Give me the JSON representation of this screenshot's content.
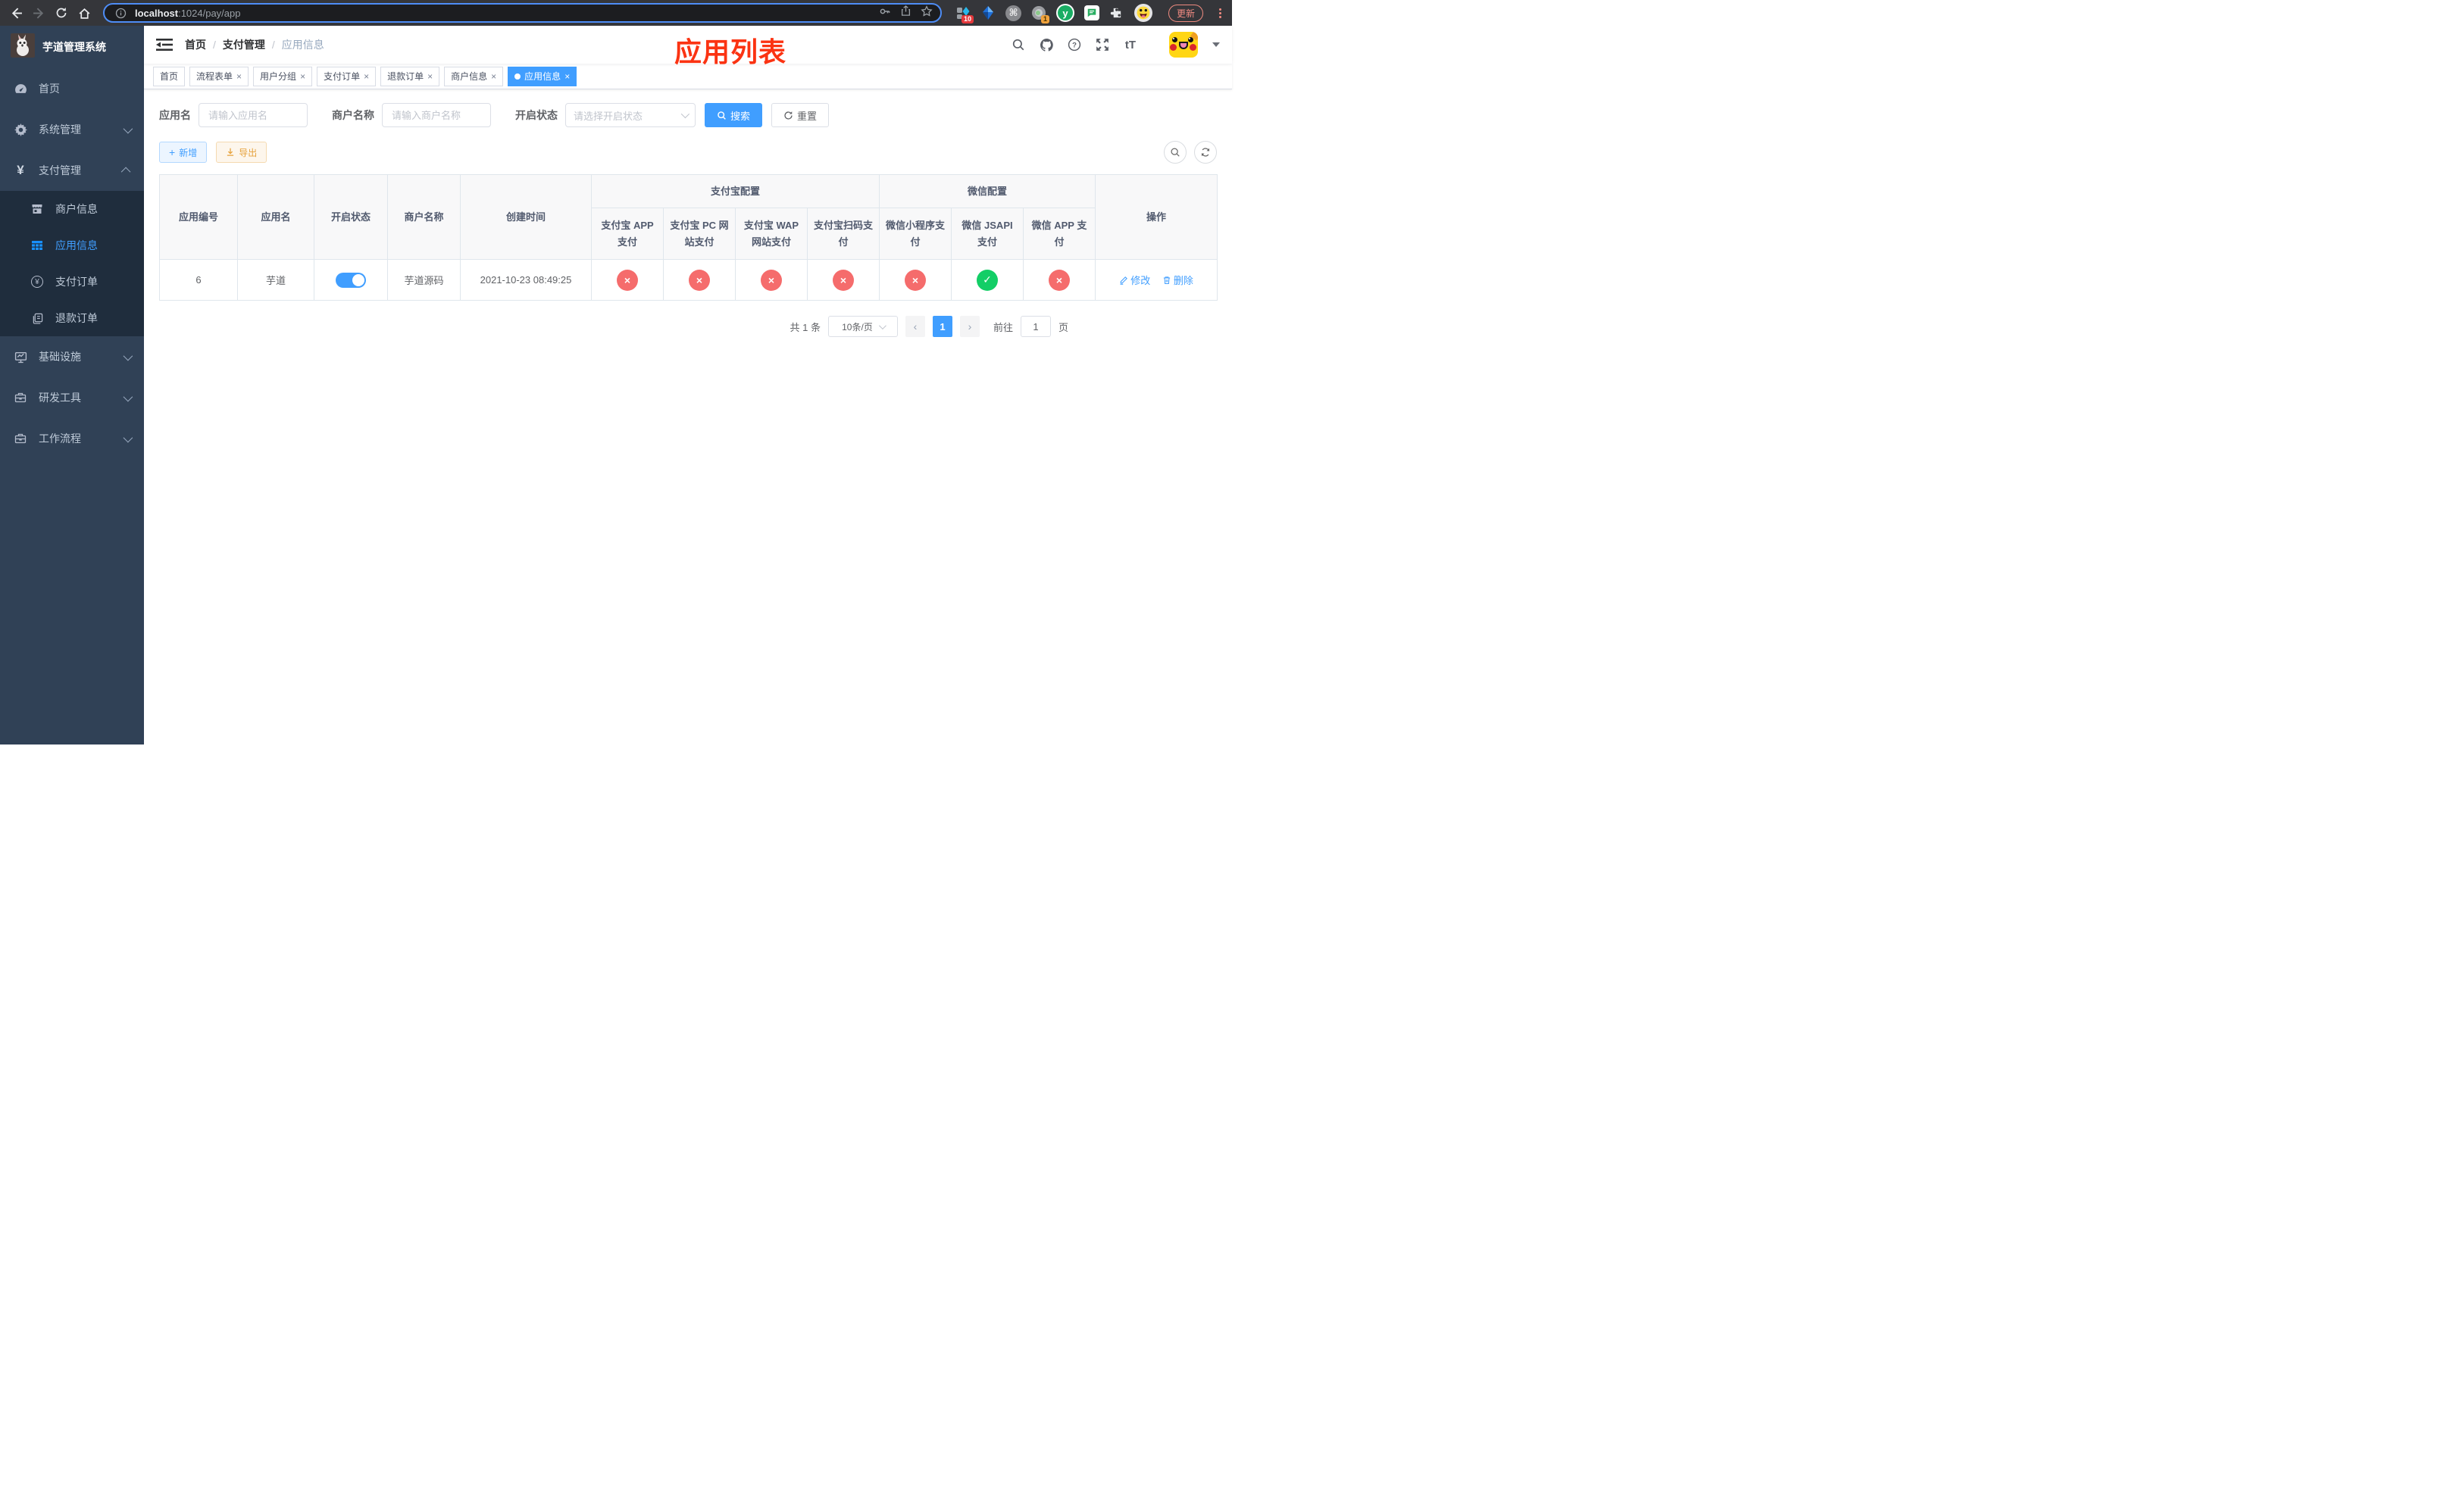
{
  "browser": {
    "url_host": "localhost",
    "url_path": ":1024/pay/app",
    "update_button": "更新",
    "ext_badge_blocks": "10",
    "ext_badge_lens": "1",
    "ext_y_letter": "y",
    "ext_command_glyph": "⌘"
  },
  "sidebar": {
    "title": "芋道管理系统",
    "items": [
      {
        "label": "首页"
      },
      {
        "label": "系统管理"
      },
      {
        "label": "支付管理"
      },
      {
        "label": "商户信息"
      },
      {
        "label": "应用信息"
      },
      {
        "label": "支付订单"
      },
      {
        "label": "退款订单"
      },
      {
        "label": "基础设施"
      },
      {
        "label": "研发工具"
      },
      {
        "label": "工作流程"
      }
    ]
  },
  "navbar": {
    "breadcrumb": [
      "首页",
      "支付管理",
      "应用信息"
    ],
    "separator": "/",
    "annotation": "应用列表",
    "fontsize_icon_text": "tT"
  },
  "tabs": [
    {
      "label": "首页",
      "closable": false,
      "active": false
    },
    {
      "label": "流程表单",
      "closable": true,
      "active": false
    },
    {
      "label": "用户分组",
      "closable": true,
      "active": false
    },
    {
      "label": "支付订单",
      "closable": true,
      "active": false
    },
    {
      "label": "退款订单",
      "closable": true,
      "active": false
    },
    {
      "label": "商户信息",
      "closable": true,
      "active": false
    },
    {
      "label": "应用信息",
      "closable": true,
      "active": true
    }
  ],
  "filters": {
    "app_name_label": "应用名",
    "app_name_placeholder": "请输入应用名",
    "merchant_label": "商户名称",
    "merchant_placeholder": "请输入商户名称",
    "status_label": "开启状态",
    "status_placeholder": "请选择开启状态",
    "search_label": "搜索",
    "reset_label": "重置"
  },
  "toolbar": {
    "add_label": "新增",
    "export_label": "导出"
  },
  "table": {
    "columns_left": [
      "应用编号",
      "应用名",
      "开启状态",
      "商户名称",
      "创建时间"
    ],
    "groups": [
      "支付宝配置",
      "微信配置"
    ],
    "channel_columns": [
      "支付宝 APP 支付",
      "支付宝 PC 网站支付",
      "支付宝 WAP 网站支付",
      "支付宝扫码支付",
      "微信小程序支付",
      "微信 JSAPI 支付",
      "微信 APP 支付"
    ],
    "ops_column": "操作",
    "rows": [
      {
        "app_id": "6",
        "app_name": "芋道",
        "enabled": true,
        "merchant": "芋道源码",
        "created": "2021-10-23 08:49:25",
        "channel_states": [
          {
            "state": "off",
            "glyph": "×"
          },
          {
            "state": "off",
            "glyph": "×"
          },
          {
            "state": "off",
            "glyph": "×"
          },
          {
            "state": "off",
            "glyph": "×"
          },
          {
            "state": "off",
            "glyph": "×"
          },
          {
            "state": "on",
            "glyph": "✓"
          },
          {
            "state": "off",
            "glyph": "×"
          }
        ],
        "edit_label": "修改",
        "delete_label": "删除"
      }
    ]
  },
  "pagination": {
    "total": "共 1 条",
    "page_size": "10条/页",
    "prev_glyph": "‹",
    "page": "1",
    "next_glyph": "›",
    "goto_label": "前往",
    "goto_value": "1",
    "page_unit": "页"
  },
  "glyphs": {
    "plus": "+",
    "close": "×",
    "yuan": "¥"
  },
  "colors": {
    "accent": "#409eff",
    "danger": "#f56c6c",
    "success": "#13ce66",
    "warning": "#e6a23c",
    "sidebar_bg": "#304156",
    "submenu_bg": "#1f2d3d",
    "annotation_red": "#fb3312"
  }
}
